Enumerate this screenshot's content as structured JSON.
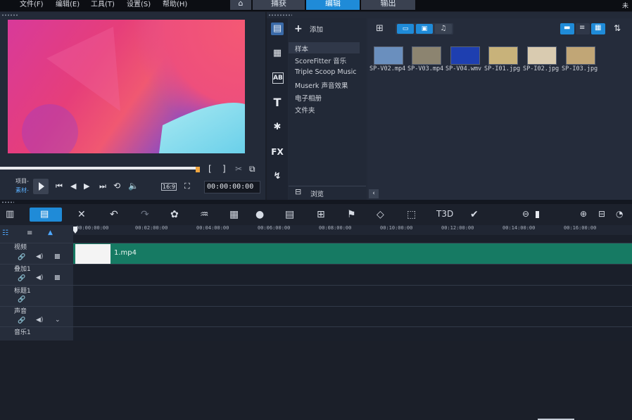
{
  "menu": {
    "items": [
      "文件(F)",
      "编辑(E)",
      "工具(T)",
      "设置(S)",
      "帮助(H)"
    ],
    "corner": "未"
  },
  "mode_tabs": {
    "home_icon": "home-icon",
    "capture": "捕获",
    "edit": "编辑",
    "share": "输出"
  },
  "preview": {
    "project_label": "项目-",
    "clip_label": "素材-",
    "aspect": "16:9",
    "timecode": "00:00:00:00"
  },
  "library": {
    "add_label": "添加",
    "folders": [
      "样本",
      "ScoreFitter 音乐",
      "Triple Scoop Music",
      "Muserk 声音效果",
      "电子相册",
      "文件夹"
    ],
    "browse_label": "浏览",
    "media": [
      {
        "name": "SP-V02.mp4",
        "color": "#6a8fbe"
      },
      {
        "name": "SP-V03.mp4",
        "color": "#8c8470"
      },
      {
        "name": "SP-V04.wmv",
        "color": "#1e3fb0"
      },
      {
        "name": "SP-I01.jpg",
        "color": "#c8b27a"
      },
      {
        "name": "SP-I02.jpg",
        "color": "#d9cbb0"
      },
      {
        "name": "SP-I03.jpg",
        "color": "#c1a676"
      }
    ]
  },
  "timeline": {
    "ruler": [
      "00:00:00:00",
      "00:02:00:00",
      "00:04:00:00",
      "00:06:00:00",
      "00:08:00:00",
      "00:10:00:00",
      "00:12:00:00",
      "00:14:00:00",
      "00:16:00:00"
    ],
    "tracks": [
      "视频",
      "叠加1",
      "标题1",
      "声音",
      "音乐1"
    ],
    "clip_name": "1.mp4",
    "clip_color": "#167a63"
  },
  "colors": {
    "accent": "#1f8bd8",
    "clip": "#167a63"
  }
}
